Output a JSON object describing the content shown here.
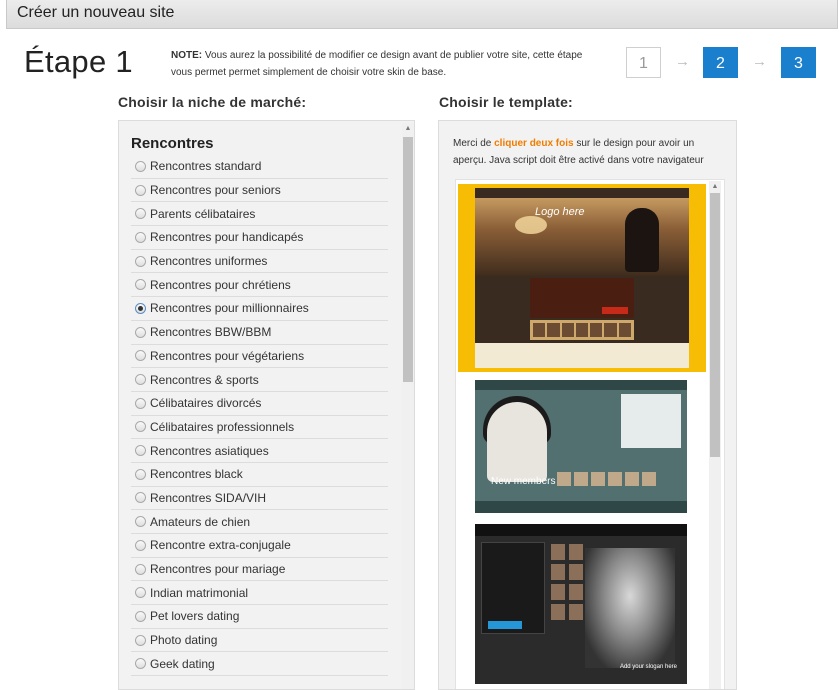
{
  "header": {
    "title": "Créer un nouveau site"
  },
  "step": {
    "title": "Étape 1"
  },
  "note": {
    "label": "NOTE:",
    "text": "Vous aurez la possibilité de modifier ce design avant de publier votre site, cette étape vous permet permet simplement de choisir votre skin de base."
  },
  "stepper": {
    "steps": [
      "1",
      "2",
      "3"
    ],
    "arrow": "→"
  },
  "niche": {
    "label": "Choisir la niche de marché:",
    "heading": "Rencontres",
    "selected": "Rencontres pour millionnaires",
    "items": [
      "Rencontres standard",
      "Rencontres pour seniors",
      "Parents célibataires",
      "Rencontres pour handicapés",
      "Rencontres uniformes",
      "Rencontres pour chrétiens",
      "Rencontres pour millionnaires",
      "Rencontres BBW/BBM",
      "Rencontres pour végétariens",
      "Rencontres & sports",
      "Célibataires divorcés",
      "Célibataires professionnels",
      "Rencontres asiatiques",
      "Rencontres black",
      "Rencontres SIDA/VIH",
      "Amateurs de chien",
      "Rencontre extra-conjugale",
      "Rencontres pour mariage",
      "Indian matrimonial",
      "Pet lovers dating",
      "Photo dating",
      "Geek dating"
    ]
  },
  "template": {
    "label": "Choisir le template:",
    "hint_before": "Merci de ",
    "hint_highlight": "cliquer deux fois",
    "hint_after": " sur le design pour avoir un aperçu. Java script doit être activé dans votre navigateur",
    "thumb1_logo": "Logo here",
    "thumb2_members": "New members",
    "thumb3_slogan": "Add your slogan here"
  },
  "colors": {
    "accent": "#1a7fcc",
    "highlight": "#f07d00",
    "selected_frame": "#f6bd04"
  }
}
